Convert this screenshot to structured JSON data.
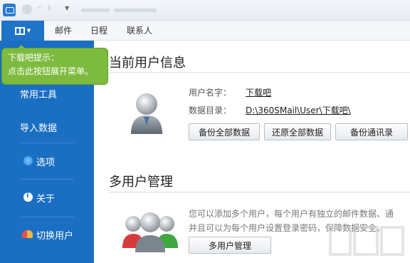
{
  "nav": {
    "tabs": [
      "邮件",
      "日程",
      "联系人"
    ]
  },
  "tooltip": {
    "line1": "下载吧提示：",
    "line2": "点击此按钮展开菜单。"
  },
  "sidebar": {
    "items": [
      {
        "label": "常用工具",
        "icon": ""
      },
      {
        "label": "导入数据",
        "icon": ""
      },
      {
        "label": "选项",
        "icon": "options-icon"
      },
      {
        "label": "关于",
        "icon": "info-icon"
      },
      {
        "label": "切换用户",
        "icon": "switch-user-icon"
      }
    ]
  },
  "current_user": {
    "heading": "当前用户信息",
    "username_label": "用户名字：",
    "username_value": "下载吧",
    "dir_label": "数据目录：",
    "dir_value": "D:\\360SMail\\User\\下载吧\\",
    "buttons": [
      "备份全部数据",
      "还原全部数据",
      "备份通讯录"
    ]
  },
  "multi_user": {
    "heading": "多用户管理",
    "desc_line1": "您可以添加多个用户，每个用户有独立的邮件数据、通",
    "desc_line2": "并且可以为每个用户设置登录密码，保障数据安全。",
    "button": "多用户管理"
  },
  "colors": {
    "sidebar": "#1a6fc3",
    "tooltip": "#7dbb3f"
  }
}
